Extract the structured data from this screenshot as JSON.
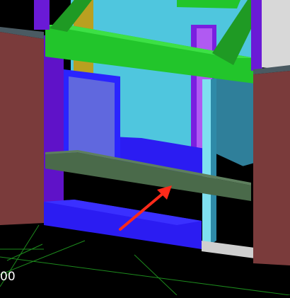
{
  "viewport": {
    "background": "#000000",
    "dimension_label": "00",
    "colors": {
      "brick_wall": "#7a3b3b",
      "beam_green": "#22c52b",
      "sky_blue_wall": "#4fc6de",
      "floor_blue": "#2b1cf2",
      "violet_frame": "#6a1ad6",
      "sill_dark_green": "#4a6a4a",
      "arrow_red": "#ff2a1a",
      "grid_line": "#1d8a1d"
    }
  }
}
